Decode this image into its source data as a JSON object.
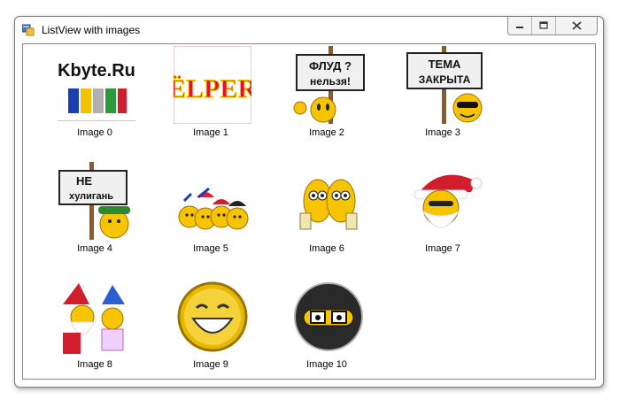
{
  "window": {
    "title": "ListView with images",
    "icon": "winforms-app-icon",
    "buttons": {
      "minimize": "minimize-icon",
      "maximize": "maximize-icon",
      "close": "close-icon"
    }
  },
  "listview": {
    "items": [
      {
        "label": "Image 0",
        "icon": "kbyte-ru-logo-image",
        "text": "Kbyte.Ru"
      },
      {
        "label": "Image 1",
        "icon": "elper-logo-image",
        "text": "ËLPER"
      },
      {
        "label": "Image 2",
        "icon": "smiley-sign-flood-image",
        "text": "ФЛУД ? нельзя!"
      },
      {
        "label": "Image 3",
        "icon": "smiley-sign-topic-closed-image",
        "text": "ТЕМА ЗАКРЫТА"
      },
      {
        "label": "Image 4",
        "icon": "smiley-sign-no-hooligans-image",
        "text": "НЕ хулигань"
      },
      {
        "label": "Image 5",
        "icon": "smiley-group-image"
      },
      {
        "label": "Image 6",
        "icon": "smiley-pair-beer-image"
      },
      {
        "label": "Image 7",
        "icon": "santa-smiley-image"
      },
      {
        "label": "Image 8",
        "icon": "santa-and-snow-maiden-image"
      },
      {
        "label": "Image 9",
        "icon": "laughing-smiley-image"
      },
      {
        "label": "Image 10",
        "icon": "ninja-smiley-image"
      }
    ]
  }
}
